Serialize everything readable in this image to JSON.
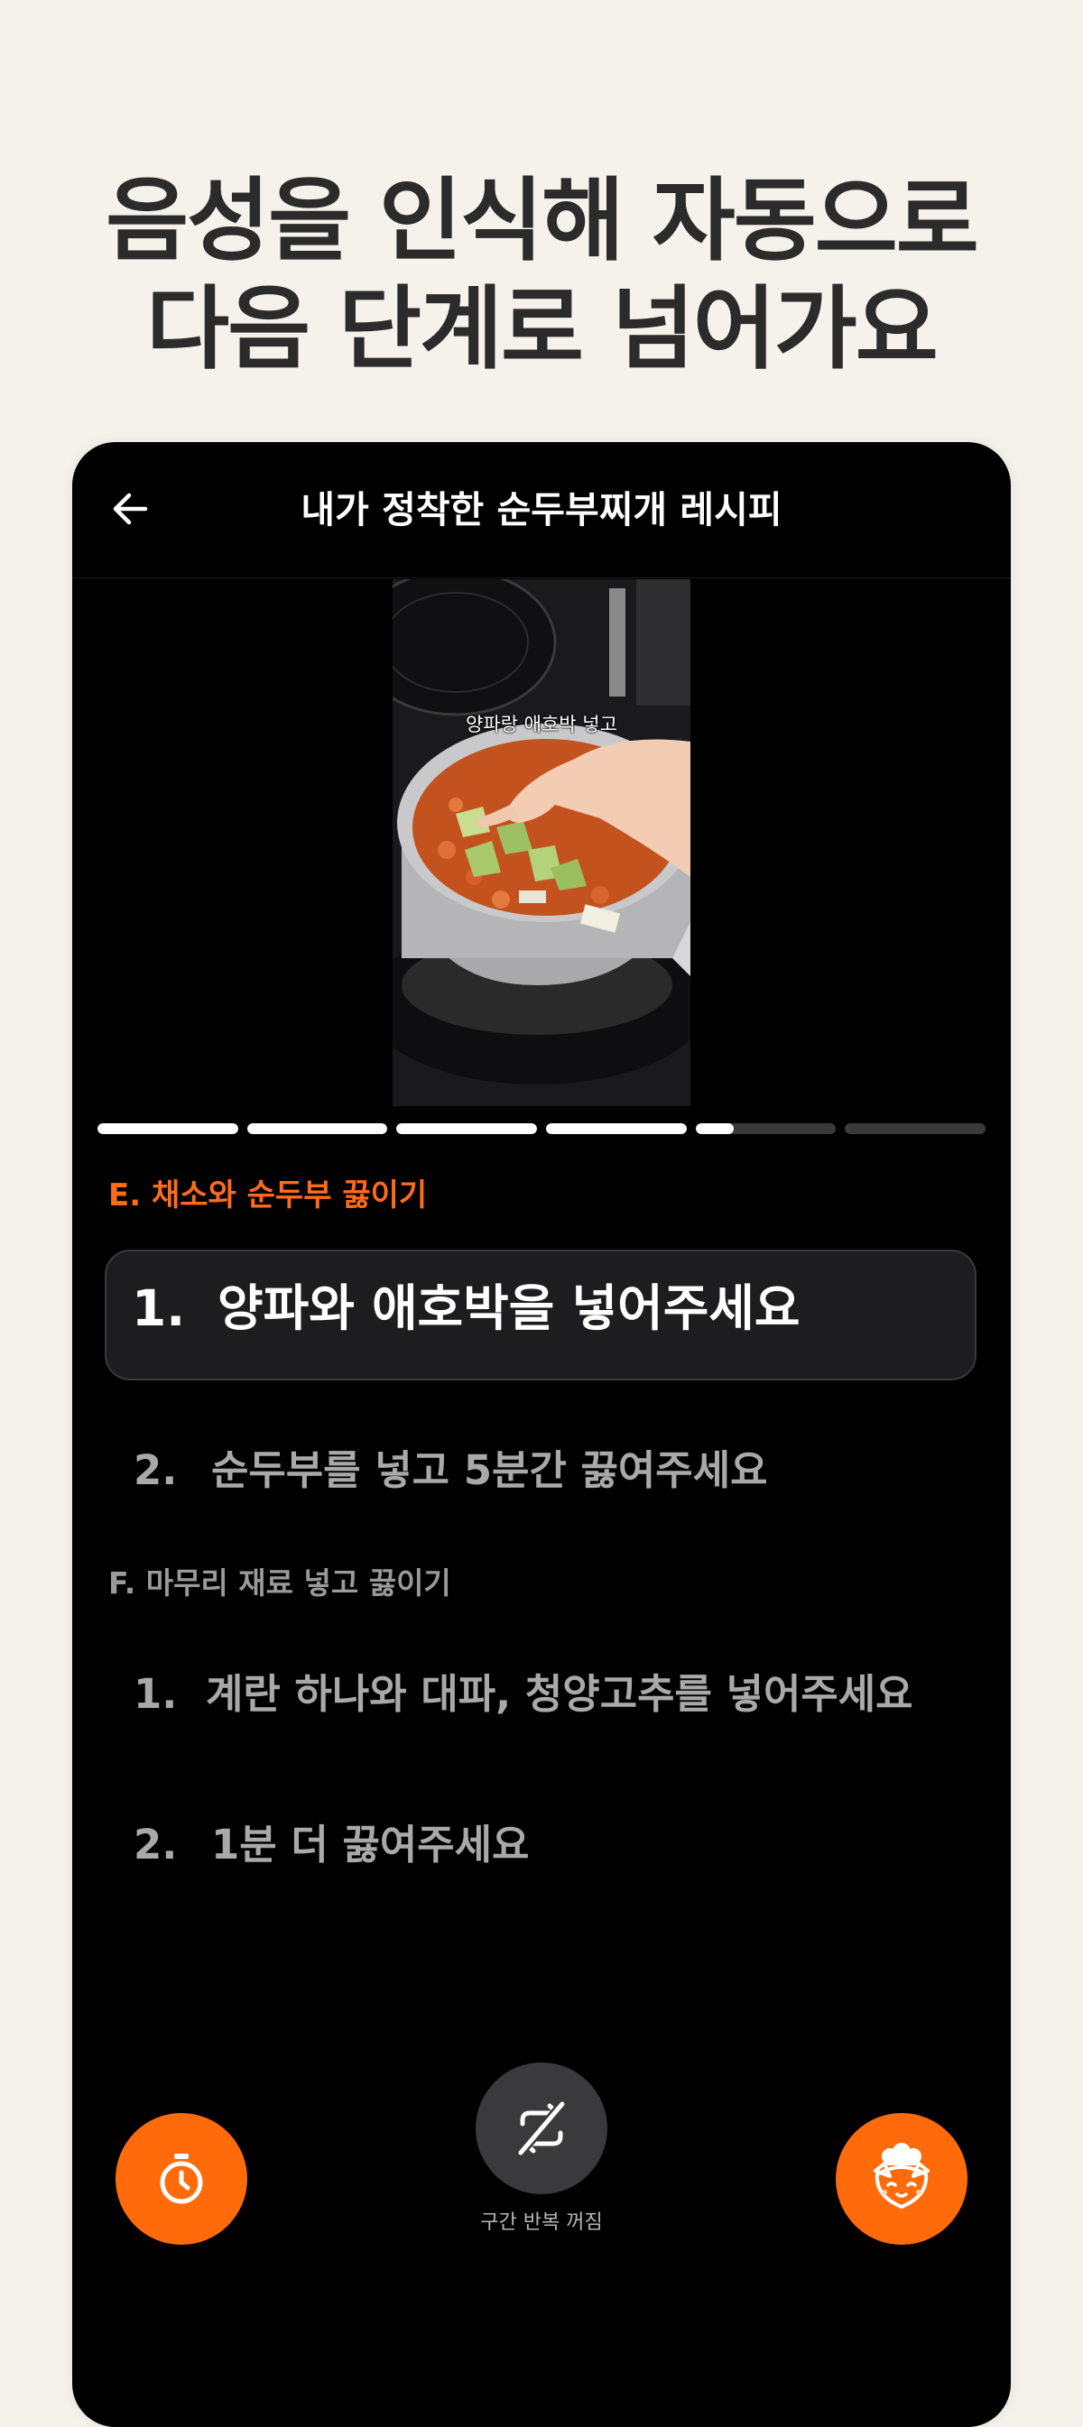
{
  "promo": {
    "headline_line1": "음성을 인식해 자동으로",
    "headline_line2": "다음 단계로 넘어가요"
  },
  "header": {
    "title": "내가 정착한 순두부찌개 레시피",
    "back_icon": "arrow-left-icon"
  },
  "video": {
    "caption": "양파랑 애호박 넣고"
  },
  "progress": {
    "segments": [
      1,
      1,
      1,
      1,
      0.27,
      0
    ]
  },
  "sections": [
    {
      "title": "E. 채소와 순두부 끓이기",
      "steps": [
        {
          "number": "1.",
          "text": "양파와 애호박을 넣어주세요"
        },
        {
          "number": "2.",
          "text": "순두부를 넣고 5분간 끓여주세요"
        }
      ]
    },
    {
      "title": "F. 마무리 재료 넣고 끓이기",
      "steps": [
        {
          "number": "1.",
          "text": "계란 하나와 대파, 청양고추를 넣어주세요"
        },
        {
          "number": "2.",
          "text": "1분 더 끓여주세요"
        }
      ]
    }
  ],
  "controls": {
    "timer_icon": "timer-icon",
    "repeat_icon": "repeat-off-icon",
    "repeat_label": "구간 반복 꺼짐",
    "assistant_icon": "chef-fox-icon"
  },
  "colors": {
    "accent": "#ff6b0a",
    "active_section": "#ff6b1a",
    "background": "#f5f2ec",
    "screen": "#000000"
  }
}
